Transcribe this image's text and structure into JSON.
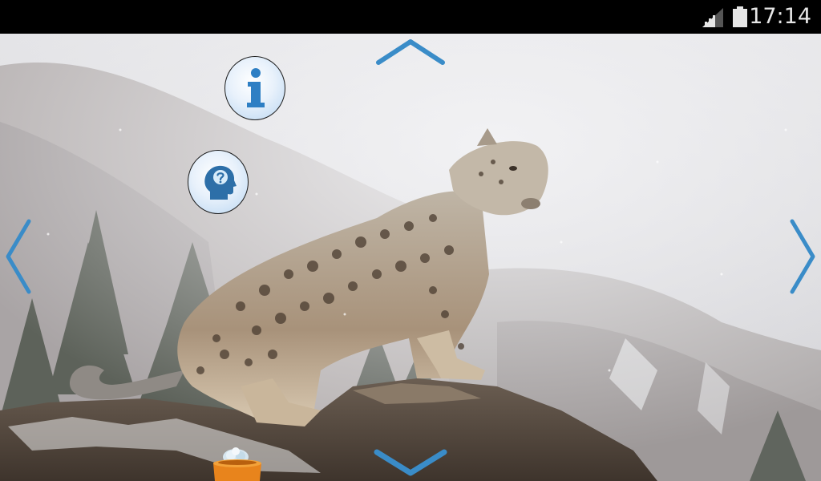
{
  "status_bar": {
    "time": "17:14",
    "signal_icon": "signal-bars-icon",
    "battery_icon": "battery-icon"
  },
  "wallpaper": {
    "subject": "snow-leopard-icon"
  },
  "buttons": {
    "info_icon": "info-icon",
    "help_icon": "head-question-icon",
    "up_icon": "chevron-up-icon",
    "down_icon": "chevron-down-icon",
    "left_icon": "chevron-left-icon",
    "right_icon": "chevron-right-icon",
    "pot_icon": "treasure-pot-icon"
  },
  "colors": {
    "arrow": "#3a8cc8",
    "info_i": "#2e7fc4",
    "status_bar_bg": "#000000",
    "pot": "#e8841c"
  }
}
